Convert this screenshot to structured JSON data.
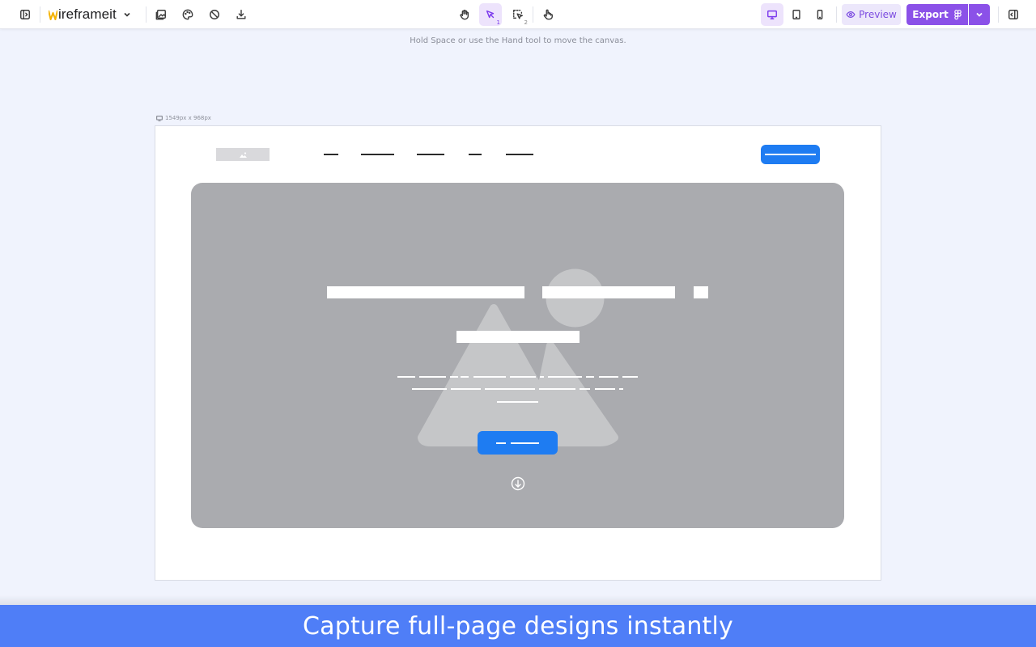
{
  "app": {
    "logo_text": "ireframeit",
    "logo_mark": "W",
    "brand_color": "#f5b300",
    "accent_color": "#8b51e8"
  },
  "toolbar": {
    "left_icons": [
      "sidebar-toggle-icon",
      "image-icon",
      "palette-icon",
      "no-icon",
      "download-icon"
    ],
    "center_tools": [
      {
        "name": "hand-tool-icon",
        "shortcut": ""
      },
      {
        "name": "select-tool-icon",
        "shortcut": "1",
        "active": true
      },
      {
        "name": "area-select-icon",
        "shortcut": "2"
      },
      {
        "name": "pointer-hand-icon",
        "shortcut": ""
      }
    ],
    "devices": [
      "desktop-icon",
      "tablet-icon",
      "mobile-icon"
    ],
    "active_device": "desktop",
    "preview_label": "Preview",
    "export_label": "Export"
  },
  "canvas": {
    "hint": "Hold Space or use the Hand tool to move the canvas.",
    "frame_size_label": "1549px x 968px"
  },
  "wireframe": {
    "cta_color": "#1e7cf2",
    "hero_color": "#aaabaf"
  },
  "banner": {
    "text": "Capture full-page designs instantly",
    "color": "#4f7ef7"
  }
}
